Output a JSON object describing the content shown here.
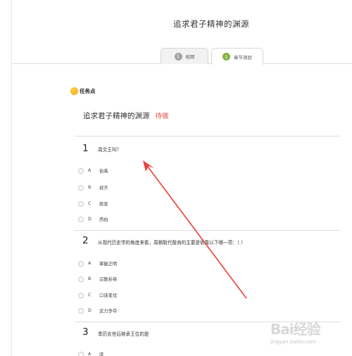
{
  "page": {
    "title": "追求君子精神的渊源"
  },
  "tabs": [
    {
      "num": "1",
      "label": "视频"
    },
    {
      "num": "2",
      "label": "章节测验"
    }
  ],
  "task_point": {
    "label": "任务点"
  },
  "chapter": {
    "title": "追求君子精神的渊源",
    "status": "待做"
  },
  "questions": [
    {
      "num": "1",
      "text": "周文王叫？",
      "options": [
        {
          "letter": "A",
          "text": "伯禹"
        },
        {
          "letter": "B",
          "text": "叔齐"
        },
        {
          "letter": "C",
          "text": "姬发"
        },
        {
          "letter": "D",
          "text": "西伯"
        }
      ]
    },
    {
      "num": "2",
      "text": "从现代历史学的角度来看，周朝取代殷商的主要是依靠以下哪一项：（ ）",
      "options": [
        {
          "letter": "A",
          "text": "掌握正明"
        },
        {
          "letter": "B",
          "text": "宗教祈祷"
        },
        {
          "letter": "C",
          "text": "口诛笔伐"
        },
        {
          "letter": "D",
          "text": "武力争夺"
        }
      ]
    },
    {
      "num": "3",
      "text": "季历去世后继承王位的是",
      "options": [
        {
          "letter": "A",
          "text": "虞"
        }
      ]
    }
  ],
  "watermark": {
    "text": "Bai经验",
    "sub": "jingyan.baidu.com"
  },
  "colors": {
    "status": "#e04a3c",
    "tab_active_badge": "#82b33f",
    "tab_inactive_badge": "#a3a3a3",
    "arrow": "#e8413a"
  }
}
